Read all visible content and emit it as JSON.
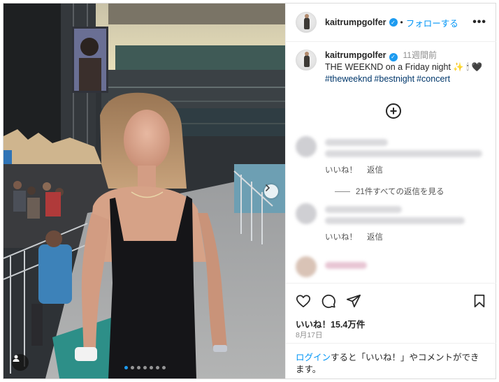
{
  "post": {
    "username": "kaitrumpgolfer",
    "follow_label": "フォローする",
    "separator": "•",
    "more_label": "•••",
    "verified_mark": "✓"
  },
  "caption": {
    "username": "kaitrumpgolfer",
    "time_ago": "11週間前",
    "text": "THE WEEKND on a Friday night ✨ 🕯 🖤",
    "hashtags": [
      "#theweeknd",
      "#bestnight",
      "#concert"
    ]
  },
  "comments": [
    {
      "like_label": "いいね！",
      "reply_label": "返信",
      "view_replies": "21件すべての返信を見る"
    },
    {
      "like_label": "いいね！",
      "reply_label": "返信"
    }
  ],
  "stats": {
    "likes": "いいね！15.4万件",
    "date": "8月17日"
  },
  "login_prompt": {
    "link": "ログイン",
    "text": "すると「いいね！」やコメントができます。"
  },
  "carousel": {
    "total_slides": 7,
    "active_slide": 1
  },
  "icons": {
    "like": "heart-icon",
    "comment": "comment-icon",
    "share": "share-icon",
    "save": "bookmark-icon",
    "more": "more-icon",
    "next": "chevron-right-icon",
    "tags": "user-tag-icon",
    "load_more": "plus-circle-icon"
  },
  "colors": {
    "link": "#0095f6",
    "hashtag": "#00376b",
    "verified": "#1d9bf0",
    "text": "#262626",
    "muted": "#8e8e8e"
  }
}
